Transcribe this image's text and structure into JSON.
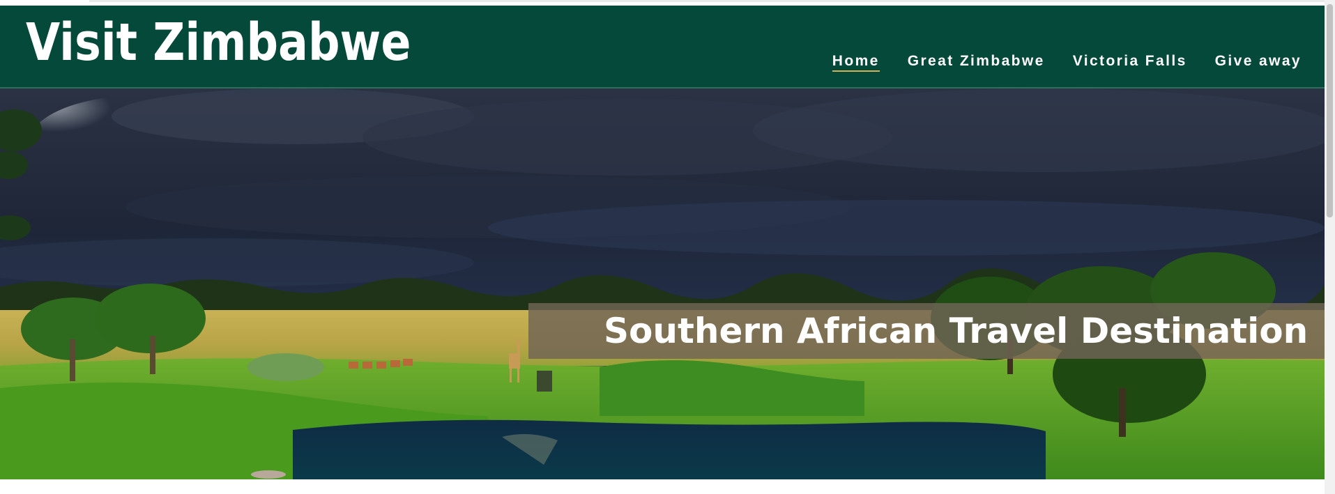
{
  "site": {
    "title": "Visit Zimbabwe"
  },
  "nav": {
    "items": [
      {
        "label": "Home",
        "active": true
      },
      {
        "label": "Great Zimbabwe",
        "active": false
      },
      {
        "label": "Victoria Falls",
        "active": false
      },
      {
        "label": "Give away",
        "active": false
      }
    ]
  },
  "hero": {
    "caption": "Southern African Travel Destination"
  },
  "colors": {
    "header_bg": "#05493a",
    "caption_bg": "#706456",
    "active_underline": "#d3b35a"
  }
}
